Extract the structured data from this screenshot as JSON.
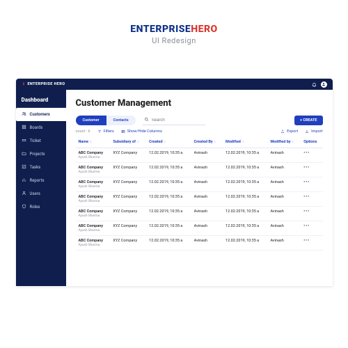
{
  "hero": {
    "logo_blue": "ENTERPRISE",
    "logo_red": "HERO",
    "subtitle": "UI Redesign"
  },
  "topbar": {
    "brand": "ENTERPRISE HERO"
  },
  "sidebar": {
    "title": "Dashboard",
    "items": [
      {
        "icon": "users",
        "label": "Customers",
        "active": true
      },
      {
        "icon": "grid",
        "label": "Boards"
      },
      {
        "icon": "ticket",
        "label": "Ticket"
      },
      {
        "icon": "folder",
        "label": "Projects"
      },
      {
        "icon": "check",
        "label": "Tasks"
      },
      {
        "icon": "bar",
        "label": "Reports"
      },
      {
        "icon": "user",
        "label": "Users"
      },
      {
        "icon": "shield",
        "label": "Roles"
      }
    ]
  },
  "page": {
    "title": "Customer Management",
    "tabs": {
      "customer": "Customer",
      "contacts": "Contacts"
    },
    "search_placeholder": "Search",
    "create": "+ CREATE",
    "count_label": "count :",
    "count_value": "6",
    "filters": "Filters",
    "columns": "Show/Hide Columns",
    "export": "Export",
    "import": "Import"
  },
  "table": {
    "headers": [
      "Name",
      "Subsidiary of",
      "Created",
      "Created By",
      "Modified",
      "Modified by",
      "Options"
    ],
    "rows": [
      {
        "name": "ABC Company",
        "name_sub": "Ayush Sharma",
        "subsidiary": "XYZ Company",
        "created": "12.02.2019, 10:35 a",
        "created_by": "Avinash",
        "modified": "12.02.2019, 10:35 a",
        "modified_by": "Avinash"
      },
      {
        "name": "ABC Company",
        "name_sub": "Ayush Sharma",
        "subsidiary": "XYZ Company",
        "created": "12.02.2019, 10:35 a",
        "created_by": "Avinash",
        "modified": "12.02.2019, 10:35 a",
        "modified_by": "Avinash"
      },
      {
        "name": "ABC Company",
        "name_sub": "Ayush Sharma",
        "subsidiary": "XYZ Company",
        "created": "12.02.2019, 10:35 a",
        "created_by": "Avinash",
        "modified": "12.02.2019, 10:35 a",
        "modified_by": "Avinash"
      },
      {
        "name": "ABC Company",
        "name_sub": "Ayush Sharma",
        "subsidiary": "XYZ Company",
        "created": "12.02.2019, 10:35 a",
        "created_by": "Avinash",
        "modified": "12.02.2019, 10:35 a",
        "modified_by": "Avinash"
      },
      {
        "name": "ABC Company",
        "name_sub": "Ayush Sharma",
        "subsidiary": "XYZ Company",
        "created": "12.02.2019, 10:35 a",
        "created_by": "Avinash",
        "modified": "12.02.2019, 10:35 a",
        "modified_by": "Avinash"
      },
      {
        "name": "ABC Company",
        "name_sub": "Ayush Sharma",
        "subsidiary": "XYZ Company",
        "created": "12.02.2019, 10:35 a",
        "created_by": "Avinash",
        "modified": "12.02.2019, 10:35 a",
        "modified_by": "Avinash"
      },
      {
        "name": "ABC Company",
        "name_sub": "Ayush Sharma",
        "subsidiary": "XYZ Company",
        "created": "12.02.2019, 10:35 a",
        "created_by": "Avinash",
        "modified": "12.02.2019, 10:35 a",
        "modified_by": "Avinash"
      }
    ]
  }
}
